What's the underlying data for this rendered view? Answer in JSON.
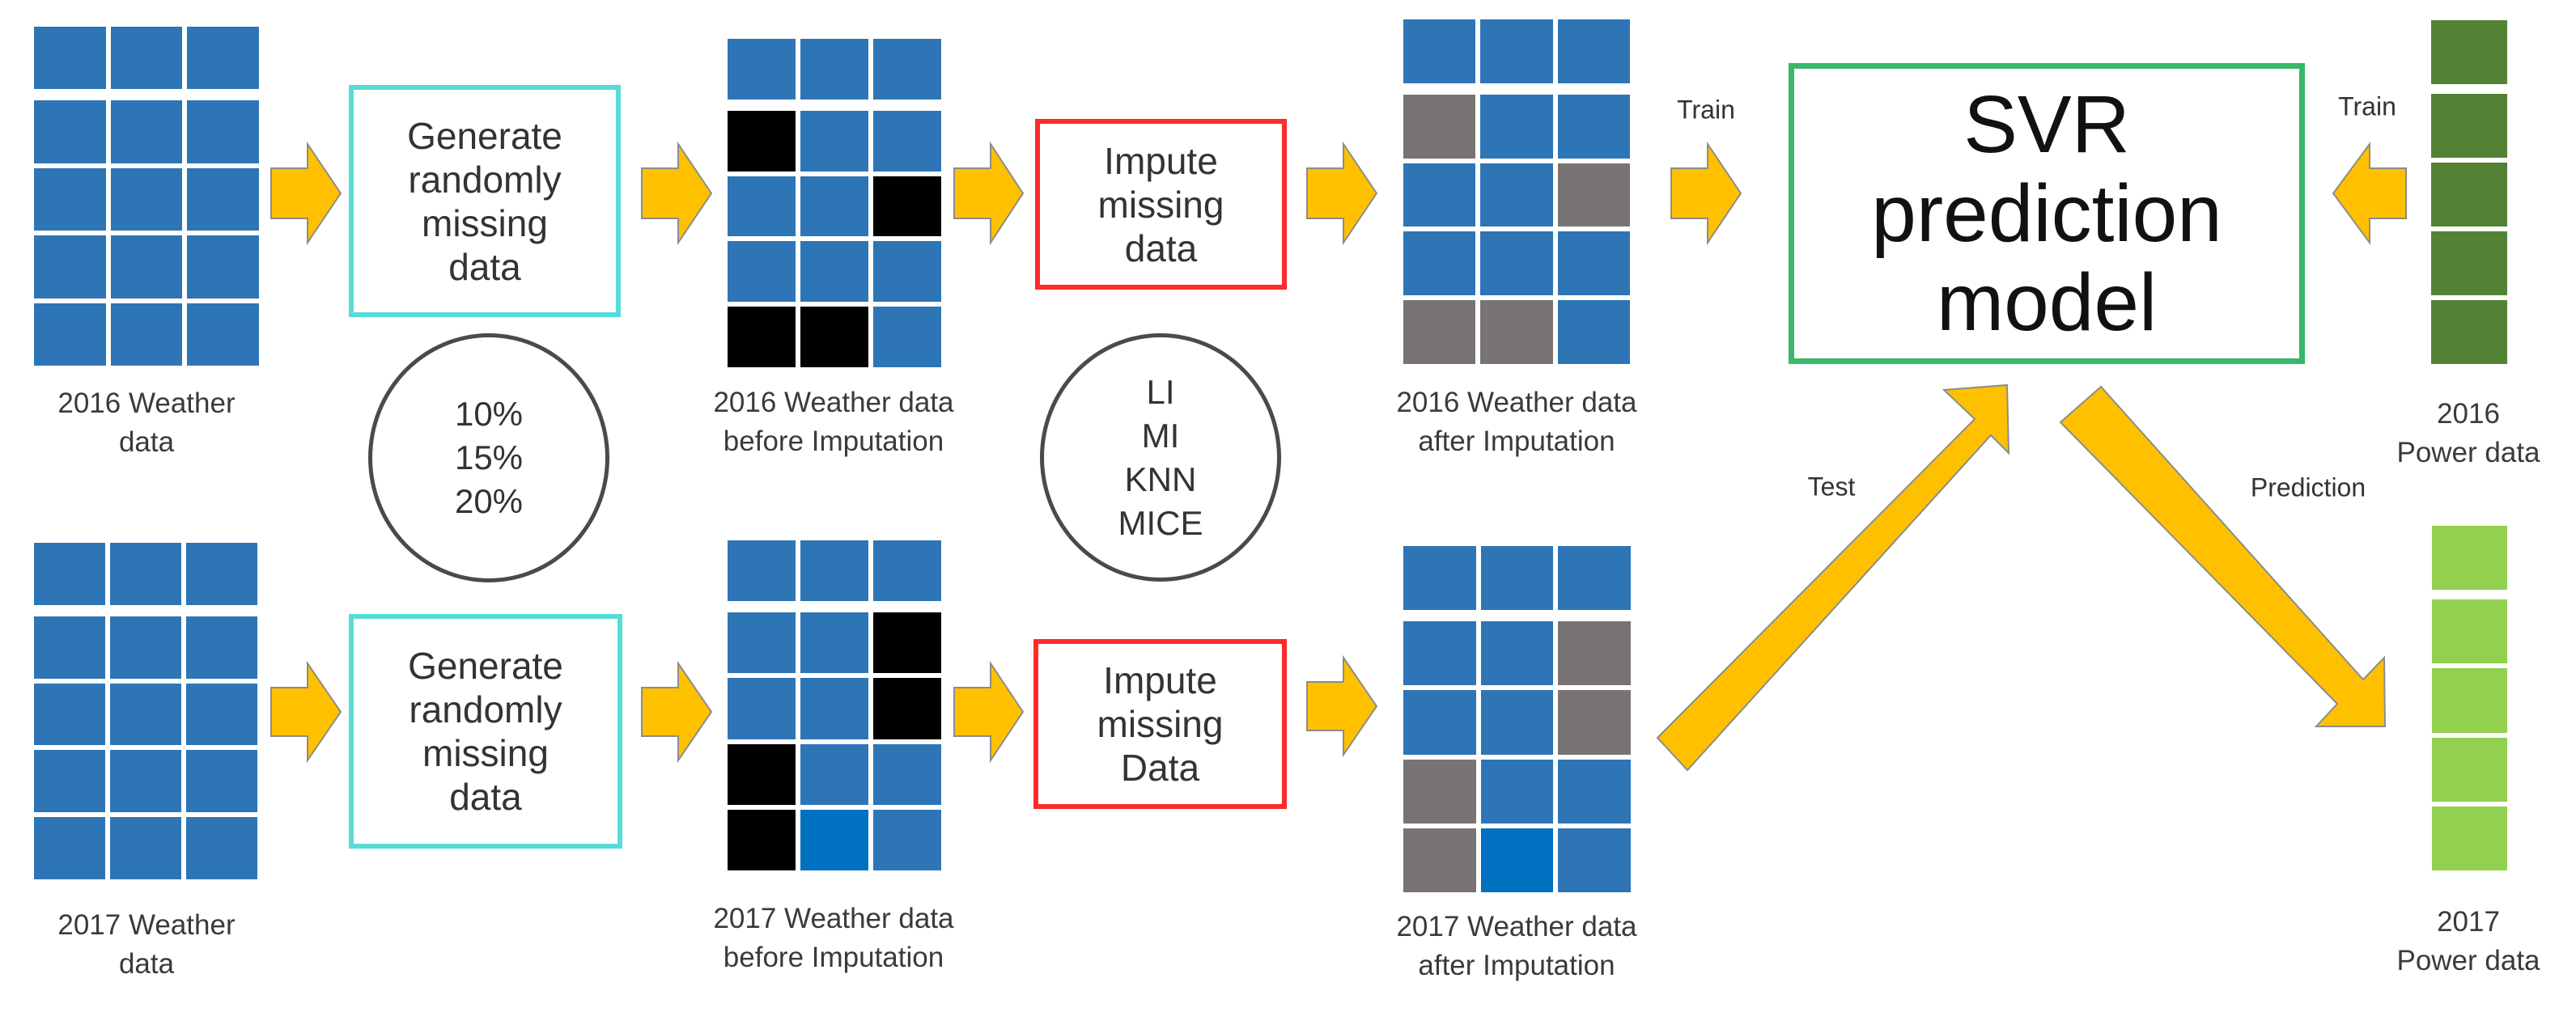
{
  "datasets": {
    "weather_2016": {
      "caption": [
        "2016 Weather",
        "data"
      ],
      "cells": [
        [
          "n",
          "n",
          "n"
        ],
        [
          "n",
          "n",
          "n"
        ],
        [
          "n",
          "n",
          "n"
        ],
        [
          "n",
          "n",
          "n"
        ],
        [
          "n",
          "n",
          "n"
        ]
      ]
    },
    "weather_2017": {
      "caption": [
        "2017 Weather",
        "data"
      ],
      "cells": [
        [
          "n",
          "n",
          "n"
        ],
        [
          "n",
          "n",
          "n"
        ],
        [
          "n",
          "n",
          "n"
        ],
        [
          "n",
          "n",
          "n"
        ],
        [
          "n",
          "n",
          "n"
        ]
      ]
    },
    "before_2016": {
      "caption": [
        "2016 Weather data",
        "before Imputation"
      ],
      "cells": [
        [
          "n",
          "n",
          "n"
        ],
        [
          "m",
          "n",
          "n"
        ],
        [
          "n",
          "n",
          "m"
        ],
        [
          "n",
          "n",
          "n"
        ],
        [
          "m",
          "m",
          "n"
        ]
      ]
    },
    "before_2017": {
      "caption": [
        "2017 Weather data",
        "before Imputation"
      ],
      "cells": [
        [
          "n",
          "n",
          "n"
        ],
        [
          "n",
          "n",
          "m"
        ],
        [
          "n",
          "n",
          "m"
        ],
        [
          "m",
          "n",
          "n"
        ],
        [
          "m",
          "b",
          "n"
        ]
      ]
    },
    "after_2016": {
      "caption": [
        "2016 Weather data",
        "after Imputation"
      ],
      "cells": [
        [
          "n",
          "n",
          "n"
        ],
        [
          "i",
          "n",
          "n"
        ],
        [
          "n",
          "n",
          "i"
        ],
        [
          "n",
          "n",
          "n"
        ],
        [
          "i",
          "i",
          "n"
        ]
      ]
    },
    "after_2017": {
      "caption": [
        "2017 Weather data",
        "after Imputation"
      ],
      "cells": [
        [
          "n",
          "n",
          "n"
        ],
        [
          "n",
          "n",
          "i"
        ],
        [
          "n",
          "n",
          "i"
        ],
        [
          "i",
          "n",
          "n"
        ],
        [
          "i",
          "b",
          "n"
        ]
      ]
    },
    "power_2016": {
      "caption": [
        "2016",
        "Power data"
      ],
      "rows": 5,
      "color": "#548235"
    },
    "power_2017": {
      "caption": [
        "2017",
        "Power data"
      ],
      "rows": 5,
      "color": "#92D050"
    }
  },
  "cell_legend": {
    "n": "observed",
    "m": "missing",
    "i": "imputed",
    "b": "observed (highlight)"
  },
  "process_boxes": {
    "generate_2016": [
      "Generate",
      "randomly",
      "missing",
      "data"
    ],
    "generate_2017": [
      "Generate",
      "randomly",
      "missing",
      "data"
    ],
    "impute_2016": [
      "Impute",
      "missing",
      "data"
    ],
    "impute_2017": [
      "Impute",
      "missing",
      "Data"
    ],
    "svr": [
      "SVR",
      "prediction",
      "model"
    ]
  },
  "missing_rates": [
    "10%",
    "15%",
    "20%"
  ],
  "imputation_methods": [
    "LI",
    "MI",
    "KNN",
    "MICE"
  ],
  "flow_labels": {
    "train_weather": "Train",
    "train_power": "Train",
    "test": "Test",
    "prediction": "Prediction"
  },
  "colors": {
    "weather_cell": "#2E75B6",
    "missing_cell": "#000000",
    "imputed_cell": "#787474",
    "highlight_cell": "#0070C0",
    "arrow": "#FFC000",
    "generate_border": "#56DDD8",
    "impute_border": "#FF2A2A",
    "svr_border": "#38B86A"
  }
}
